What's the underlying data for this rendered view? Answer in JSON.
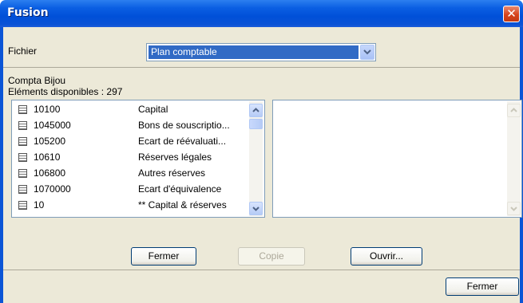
{
  "window": {
    "title": "Fusion",
    "close_glyph": "✕"
  },
  "fichier": {
    "label": "Fichier",
    "selected": "Plan comptable"
  },
  "source": {
    "name": "Compta Bijou",
    "count_label": "Eléments disponibles : 297"
  },
  "list": {
    "items": [
      {
        "code": "10100",
        "name": "Capital"
      },
      {
        "code": "1045000",
        "name": "Bons de souscriptio..."
      },
      {
        "code": "105200",
        "name": "Ecart de réévaluati..."
      },
      {
        "code": "10610",
        "name": "Réserves légales"
      },
      {
        "code": "106800",
        "name": "Autres réserves"
      },
      {
        "code": "1070000",
        "name": "Ecart d'équivalence"
      },
      {
        "code": "10",
        "name": "** Capital & réserves"
      }
    ]
  },
  "buttons": {
    "fermer_inner": "Fermer",
    "copie": "Copie",
    "ouvrir": "Ouvrir...",
    "fermer": "Fermer"
  }
}
